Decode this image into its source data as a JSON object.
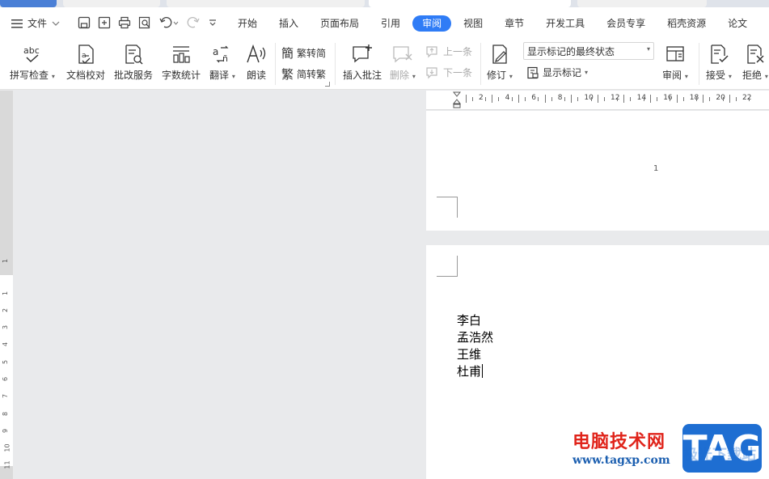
{
  "menu": {
    "file_label": "文件",
    "tabs": [
      "开始",
      "插入",
      "页面布局",
      "引用",
      "审阅",
      "视图",
      "章节",
      "开发工具",
      "会员专享",
      "稻壳资源",
      "论文"
    ],
    "active_tab": "审阅"
  },
  "ribbon": {
    "spell_check": "拼写检查",
    "doc_proof": "文档校对",
    "revise_service": "批改服务",
    "word_count": "字数统计",
    "translate": "翻译",
    "read_aloud": "朗读",
    "trad_to_simp": "繁转简",
    "simp_to_trad": "简转繁",
    "insert_comment": "插入批注",
    "delete": "删除",
    "prev": "上一条",
    "next": "下一条",
    "track_changes": "修订",
    "markup_select_value": "显示标记的最终状态",
    "show_markup": "显示标记",
    "review": "审阅",
    "accept": "接受",
    "reject": "拒绝"
  },
  "ruler": {
    "h_labels": [
      "2",
      "4",
      "6",
      "8",
      "10",
      "12",
      "14",
      "16",
      "18",
      "20",
      "22"
    ],
    "v_labels": [
      "1",
      "1",
      "2",
      "3",
      "4",
      "5",
      "6",
      "7",
      "8",
      "9",
      "10",
      "11"
    ]
  },
  "document": {
    "page_number": "1",
    "lines": [
      "李白",
      "孟浩然",
      "王维",
      "杜甫"
    ]
  },
  "watermark": {
    "site_name": "电脑技术网",
    "url": "www.tagxp.com",
    "tag": "TAG",
    "faint": "极光下载站"
  },
  "colors": {
    "accent": "#2f7cf6",
    "watermark_red": "#e0241b",
    "watermark_blue": "#1e6ed2"
  }
}
